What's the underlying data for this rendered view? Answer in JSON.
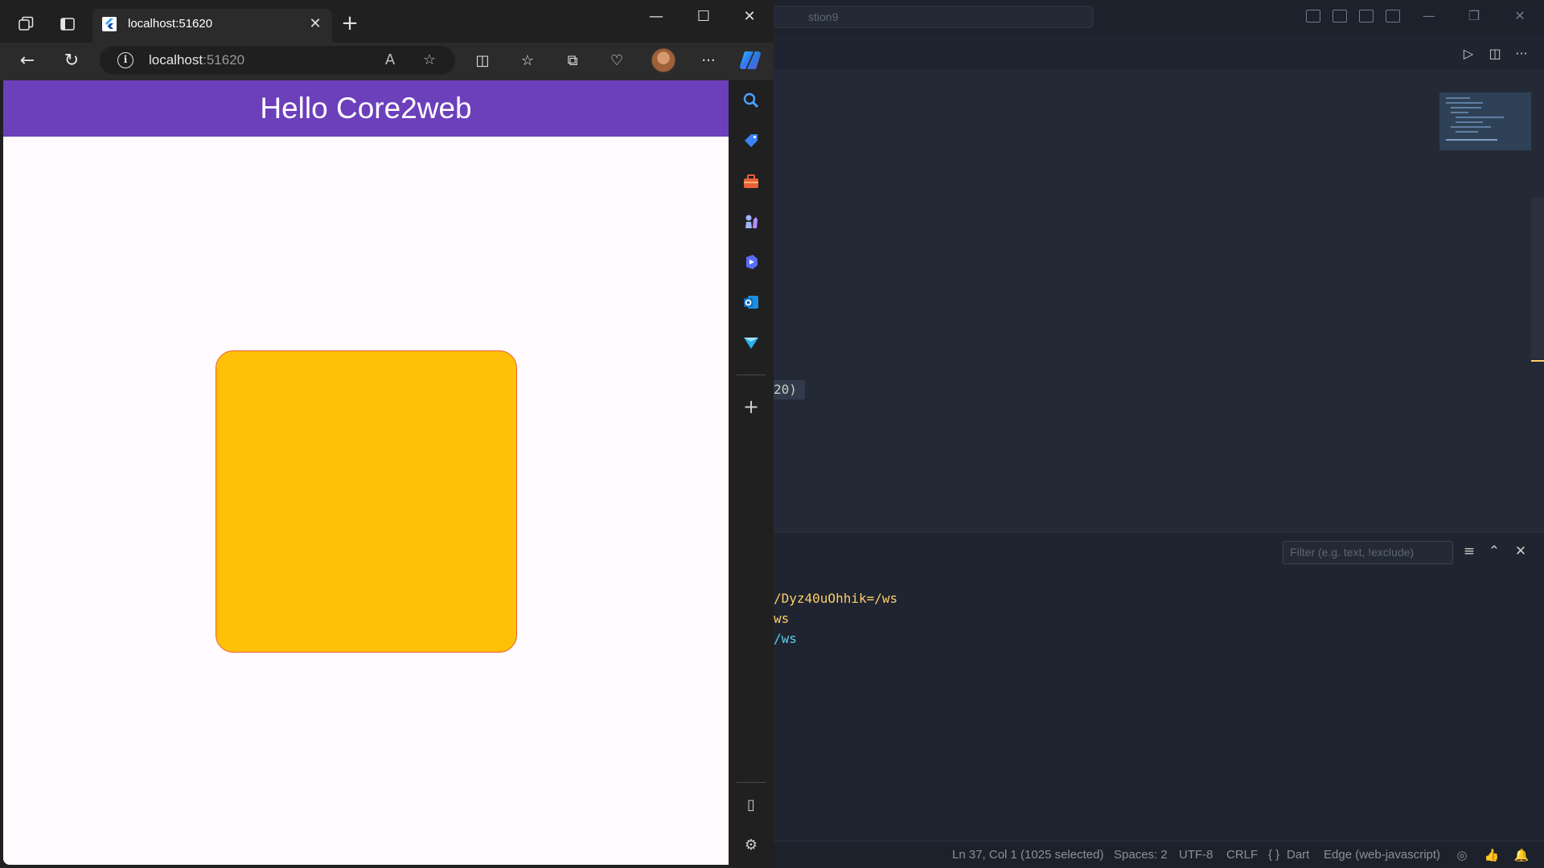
{
  "vscode": {
    "command_center_text": "stion9",
    "code_fragment": "20)",
    "output_lines": [
      {
        "text": "/Dyz40uOhhik=/ws",
        "color": "#ffcc66"
      },
      {
        "text": "ws",
        "color": "#ffcc66"
      },
      {
        "text": "/ws",
        "color": "#5ccfe6"
      }
    ],
    "filter_placeholder": "Filter (e.g. text, !exclude)",
    "status": {
      "position": "Ln 37, Col 1 (1025 selected)",
      "spaces": "Spaces: 2",
      "encoding": "UTF-8",
      "eol": "CRLF",
      "language_glyph": "{ }",
      "language": "Dart",
      "debug_target": "Edge (web-javascript)"
    },
    "colors": {
      "accent": "#ffcc66",
      "editor_bg": "#242936",
      "titlebar_bg": "#1c212b"
    }
  },
  "edge": {
    "tab_title": "localhost:51620",
    "url_host": "localhost",
    "url_port": ":51620",
    "icons": {
      "back": "arrow-left-icon",
      "refresh": "refresh-icon",
      "read_aloud": "read-aloud-icon",
      "favorite": "star-icon",
      "split_screen": "split-screen-icon",
      "favorites": "favorites-icon",
      "collections": "collections-icon",
      "performance": "heartbeat-icon",
      "more": "more-icon"
    },
    "glyphs": {
      "close": "✕",
      "plus": "+",
      "minimize": "—",
      "maximize": "☐",
      "back": "←",
      "refresh": "↻",
      "read_aloud": "A",
      "star": "☆",
      "split": "◫",
      "favorites": "☆",
      "collections": "⧉",
      "health": "♡",
      "more": "···",
      "sidebar_toggle": "▯",
      "settings": "⚙",
      "info": "i",
      "play": "▷",
      "split_editor": "◫",
      "editor_more": "···",
      "panel_menu": "≡",
      "panel_chevron": "⌃",
      "restore": "❐",
      "bell": "🔔",
      "thumb": "👍",
      "copilot": "◎"
    }
  },
  "app": {
    "title": "Hello Core2web",
    "appbar_color": "#6c3fbb",
    "box_color": "#ffc107",
    "box_border_color": "#ef5a3c"
  }
}
